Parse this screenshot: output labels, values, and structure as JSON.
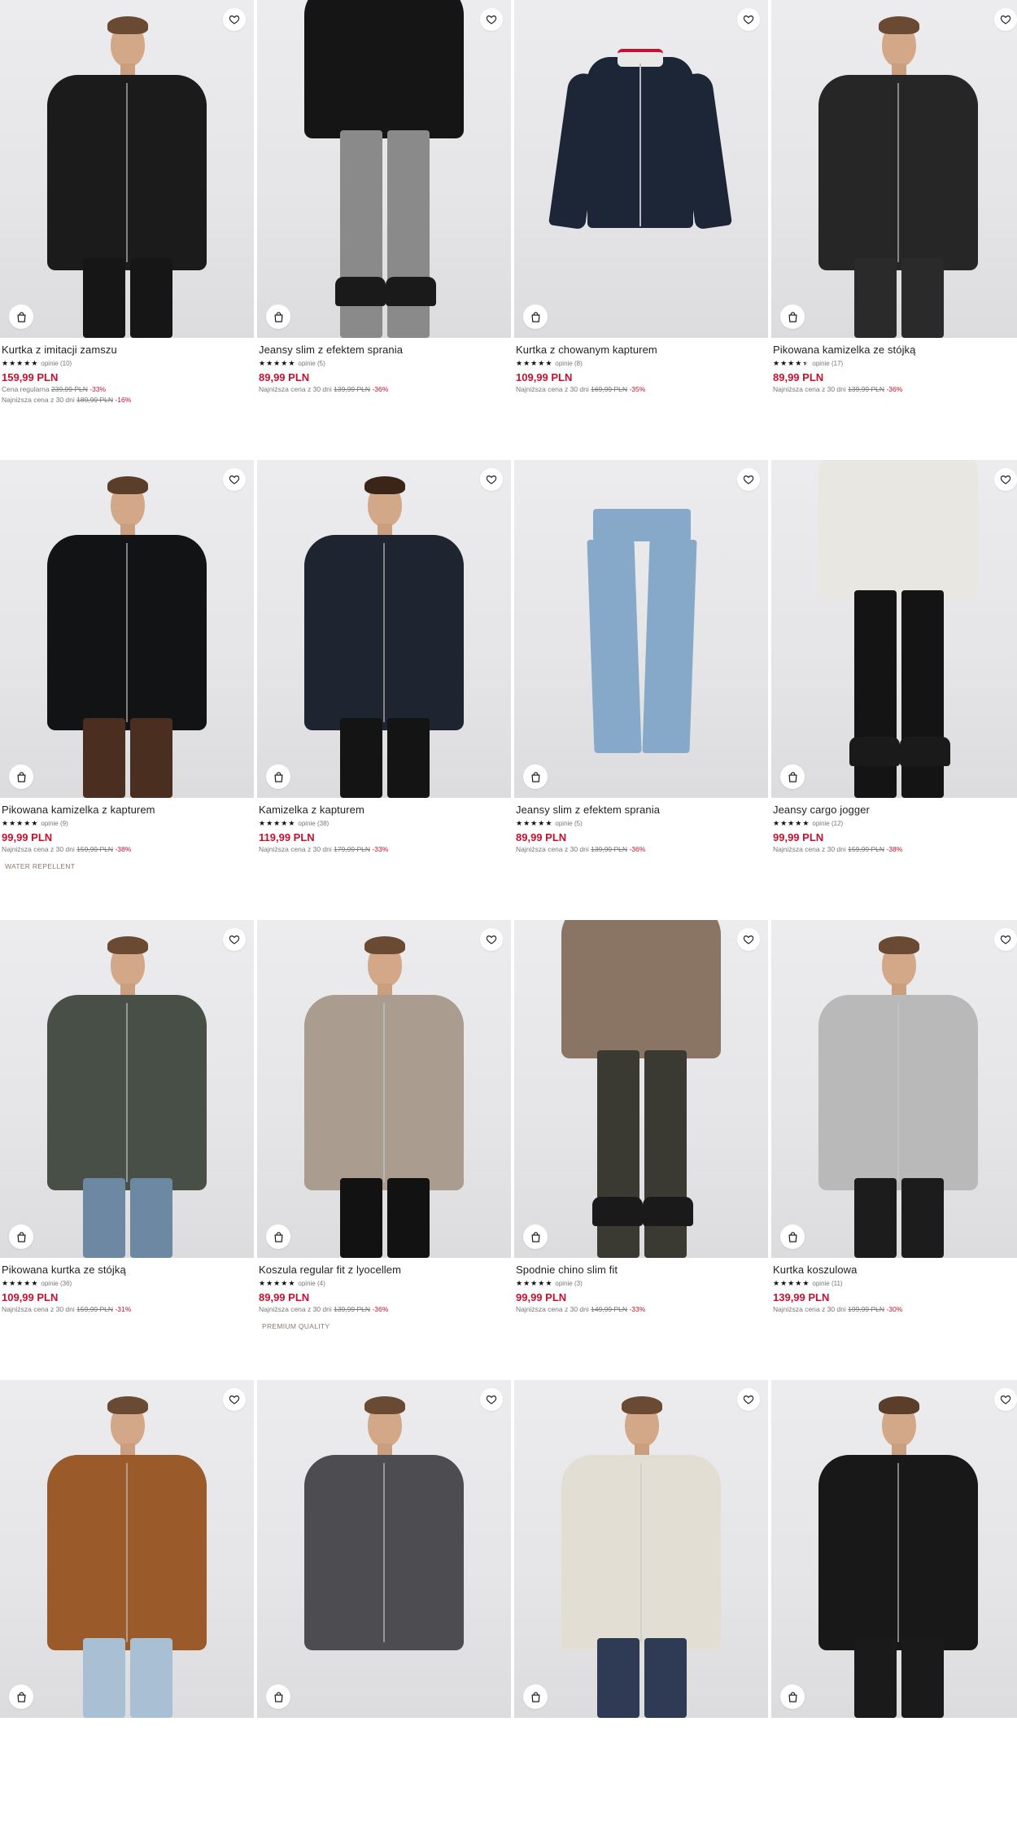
{
  "colors": {
    "price": "#c8102e",
    "text": "#222222",
    "muted": "#777777",
    "badge": "#8a7a6a"
  },
  "products": [
    {
      "name": "Kurtka z imitacji zamszu",
      "stars": 5,
      "reviews": "opinie (10)",
      "price": "159,99 PLN",
      "lines": [
        {
          "label": "Cena regularna",
          "old": "239,99 PLN",
          "disc": "-33%"
        },
        {
          "label": "Najniższa cena z 30 dni",
          "old": "189,99 PLN",
          "disc": "-16%"
        }
      ],
      "badge": "",
      "fav_icon": "heart-icon",
      "bag_icon": "shopping-bag-icon"
    },
    {
      "name": "Jeansy slim z efektem sprania",
      "stars": 5,
      "reviews": "opinie (5)",
      "price": "89,99 PLN",
      "lines": [
        {
          "label": "Najniższa cena z 30 dni",
          "old": "139,99 PLN",
          "disc": "-36%"
        }
      ],
      "badge": ""
    },
    {
      "name": "Kurtka z chowanym kapturem",
      "stars": 5,
      "reviews": "opinie (8)",
      "price": "109,99 PLN",
      "lines": [
        {
          "label": "Najniższa cena z 30 dni",
          "old": "169,99 PLN",
          "disc": "-35%"
        }
      ],
      "badge": ""
    },
    {
      "name": "Pikowana kamizelka ze stójką",
      "stars": 4.5,
      "reviews": "opinie (17)",
      "price": "89,99 PLN",
      "lines": [
        {
          "label": "Najniższa cena z 30 dni",
          "old": "139,99 PLN",
          "disc": "-36%"
        }
      ],
      "badge": ""
    },
    {
      "name": "Pikowana kamizelka z kapturem",
      "stars": 5,
      "reviews": "opinie (9)",
      "price": "99,99 PLN",
      "lines": [
        {
          "label": "Najniższa cena z 30 dni",
          "old": "159,99 PLN",
          "disc": "-38%"
        }
      ],
      "badge": "WATER REPELLENT"
    },
    {
      "name": "Kamizelka z kapturem",
      "stars": 5,
      "reviews": "opinie (38)",
      "price": "119,99 PLN",
      "lines": [
        {
          "label": "Najniższa cena z 30 dni",
          "old": "179,99 PLN",
          "disc": "-33%"
        }
      ],
      "badge": ""
    },
    {
      "name": "Jeansy slim z efektem sprania",
      "stars": 5,
      "reviews": "opinie (5)",
      "price": "89,99 PLN",
      "lines": [
        {
          "label": "Najniższa cena z 30 dni",
          "old": "139,99 PLN",
          "disc": "-36%"
        }
      ],
      "badge": ""
    },
    {
      "name": "Jeansy cargo jogger",
      "stars": 5,
      "reviews": "opinie (12)",
      "price": "99,99 PLN",
      "lines": [
        {
          "label": "Najniższa cena z 30 dni",
          "old": "159,99 PLN",
          "disc": "-38%"
        }
      ],
      "badge": ""
    },
    {
      "name": "Pikowana kurtka ze stójką",
      "stars": 5,
      "reviews": "opinie (36)",
      "price": "109,99 PLN",
      "lines": [
        {
          "label": "Najniższa cena z 30 dni",
          "old": "159,99 PLN",
          "disc": "-31%"
        }
      ],
      "badge": ""
    },
    {
      "name": "Koszula regular fit z lyocellem",
      "stars": 5,
      "reviews": "opinie (4)",
      "price": "89,99 PLN",
      "lines": [
        {
          "label": "Najniższa cena z 30 dni",
          "old": "139,99 PLN",
          "disc": "-36%"
        }
      ],
      "badge": "PREMIUM QUALITY"
    },
    {
      "name": "Spodnie chino slim fit",
      "stars": 5,
      "reviews": "opinie (3)",
      "price": "99,99 PLN",
      "lines": [
        {
          "label": "Najniższa cena z 30 dni",
          "old": "149,99 PLN",
          "disc": "-33%"
        }
      ],
      "badge": ""
    },
    {
      "name": "Kurtka koszulowa",
      "stars": 5,
      "reviews": "opinie (11)",
      "price": "139,99 PLN",
      "lines": [
        {
          "label": "Najniższa cena z 30 dni",
          "old": "199,99 PLN",
          "disc": "-30%"
        }
      ],
      "badge": ""
    },
    {
      "name": "",
      "stars": 0,
      "reviews": "",
      "price": "",
      "lines": [],
      "badge": ""
    },
    {
      "name": "",
      "stars": 0,
      "reviews": "",
      "price": "",
      "lines": [],
      "badge": ""
    },
    {
      "name": "",
      "stars": 0,
      "reviews": "",
      "price": "",
      "lines": [],
      "badge": ""
    },
    {
      "name": "",
      "stars": 0,
      "reviews": "",
      "price": "",
      "lines": [],
      "badge": ""
    }
  ],
  "images": [
    {
      "kind": "black suede jacket",
      "top": "#1b1b1b",
      "legs": "#161616",
      "hair": "#6a4a32"
    },
    {
      "kind": "grey washed jeans",
      "top": "#151515",
      "legs": "#8a8a8a",
      "hair": "#6a4a32"
    },
    {
      "kind": "navy jacket flatlay",
      "top": "#1d2636",
      "legs": "",
      "hair": ""
    },
    {
      "kind": "quilted vest",
      "top": "#262626",
      "legs": "#2a2a2a",
      "hair": "#6a4a32"
    },
    {
      "kind": "glossy puffer vest",
      "top": "#121315",
      "legs": "#4a2e1f",
      "hair": "#5a3e2a"
    },
    {
      "kind": "hooded vest",
      "top": "#1f2530",
      "legs": "#141414",
      "hair": "#3a2518"
    },
    {
      "kind": "light blue jeans flatlay",
      "top": "#86a9c9",
      "legs": "",
      "hair": ""
    },
    {
      "kind": "black cargo joggers",
      "top": "#e9e7e2",
      "legs": "#141414",
      "hair": ""
    },
    {
      "kind": "khaki puffer jacket",
      "top": "#474f46",
      "legs": "#6c88a3",
      "hair": "#6a4a32"
    },
    {
      "kind": "beige shirt",
      "top": "#aa9c8e",
      "legs": "#121212",
      "hair": "#6a4a32"
    },
    {
      "kind": "dark olive chinos",
      "top": "#8a7564",
      "legs": "#3a3a33",
      "hair": ""
    },
    {
      "kind": "grey overshirt",
      "top": "#b9b9b9",
      "legs": "#1c1c1c",
      "hair": "#6a4a32"
    },
    {
      "kind": "camel suede jacket",
      "top": "#9a5a2a",
      "legs": "#a9c0d4",
      "hair": "#6a4a32"
    },
    {
      "kind": "grey knit polo",
      "top": "#4d4d51",
      "legs": "",
      "hair": "#6a4a32"
    },
    {
      "kind": "cream zip jacket",
      "top": "#e3ded3",
      "legs": "#2f3a55",
      "hair": "#6a4a32"
    },
    {
      "kind": "black wool vest",
      "top": "#181818",
      "legs": "#1a1a1a",
      "hair": "#5a3e2a"
    }
  ]
}
